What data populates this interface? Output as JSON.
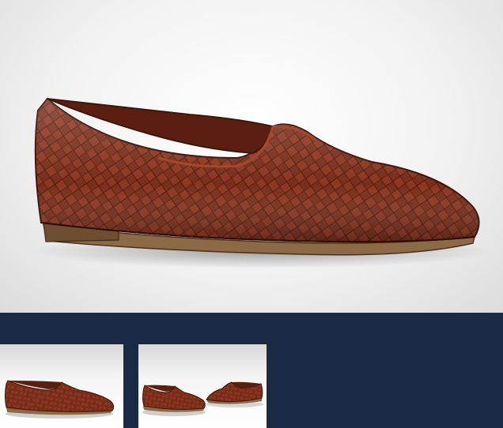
{
  "gallery": {
    "main_image": {
      "icon": "woven-leather-loafer-side-view",
      "colors": {
        "leather": "#7a2e1a",
        "leather_highlight": "#a8482a",
        "leather_shadow": "#4a1a0e",
        "sole": "#8b6a45"
      }
    },
    "thumbnails": [
      {
        "icon": "woven-leather-loafer-side-view",
        "selected": true
      },
      {
        "icon": "woven-leather-loafer-pair-view",
        "selected": false
      }
    ],
    "background_color": "#1a2a45"
  }
}
